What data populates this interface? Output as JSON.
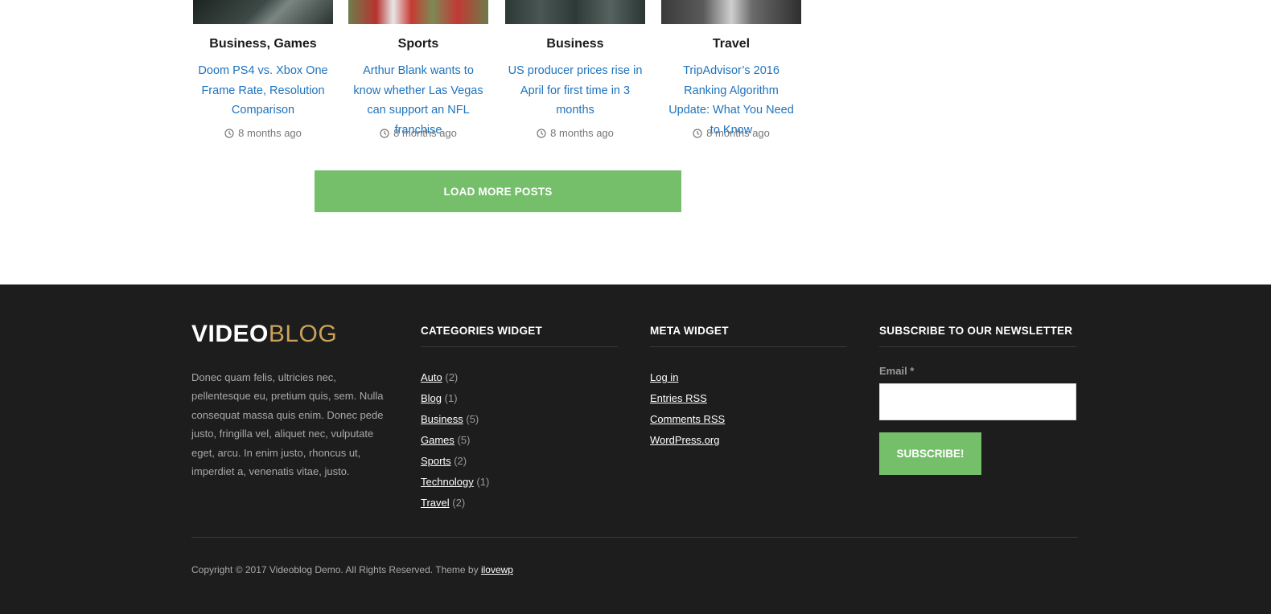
{
  "posts": [
    {
      "category": "Business, Games",
      "title": "Doom PS4 vs. Xbox One Frame Rate, Resolution Comparison",
      "time": "8 months ago"
    },
    {
      "category": "Sports",
      "title": "Arthur Blank wants to know whether Las Vegas can support an NFL franchise",
      "time": "8 months ago"
    },
    {
      "category": "Business",
      "title": "US producer prices rise in April for first time in 3 months",
      "time": "8 months ago"
    },
    {
      "category": "Travel",
      "title": "TripAdvisor’s 2016 Ranking Algorithm Update: What You Need to Know",
      "time": "8 months ago"
    }
  ],
  "load_more_label": "LOAD MORE POSTS",
  "footer": {
    "logo_part1": "VIDEO",
    "logo_part2": "BLOG",
    "about": "Donec quam felis, ultricies nec, pellentesque eu, pretium quis, sem. Nulla consequat massa quis enim. Donec pede justo, fringilla vel, aliquet nec, vulputate eget, arcu. In enim justo, rhoncus ut, imperdiet a, venenatis vitae, justo.",
    "categories": {
      "title": "CATEGORIES WIDGET",
      "items": [
        {
          "label": "Auto",
          "count": "(2)"
        },
        {
          "label": "Blog",
          "count": "(1)"
        },
        {
          "label": "Business",
          "count": "(5)"
        },
        {
          "label": "Games",
          "count": "(5)"
        },
        {
          "label": "Sports",
          "count": "(2)"
        },
        {
          "label": "Technology",
          "count": "(1)"
        },
        {
          "label": "Travel",
          "count": "(2)"
        }
      ]
    },
    "meta": {
      "title": "META WIDGET",
      "items": [
        "Log in",
        "Entries RSS",
        "Comments RSS",
        "WordPress.org"
      ]
    },
    "newsletter": {
      "title": "SUBSCRIBE TO OUR NEWSLETTER",
      "email_label": "Email *",
      "button_label": "SUBSCRIBE!"
    },
    "copyright": "Copyright © 2017 Videoblog Demo. All Rights Reserved. Theme by",
    "copyright_link": "ilovewp"
  },
  "colors": {
    "accent": "#75bf6b",
    "link": "#1e73be",
    "footer_bg": "#1d1d1d",
    "logo_gold": "#c9a25a"
  }
}
